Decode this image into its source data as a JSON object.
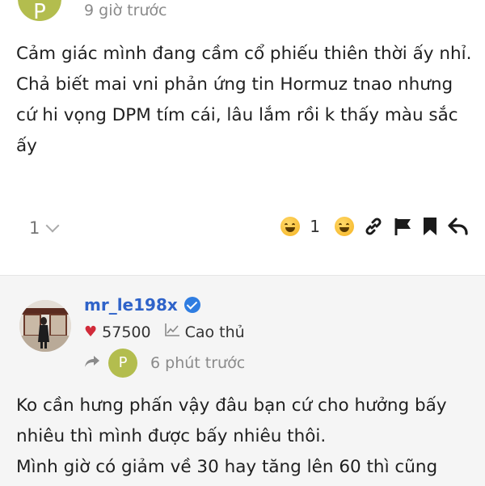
{
  "post1": {
    "avatar_letter": "P",
    "time": "9 giờ trước",
    "body": "Cảm giác mình đang cầm cổ phiếu thiên thời ấy nhỉ. Chả biết mai vni phản ứng tin Hormuz tnao nhưng cứ hi vọng DPM tím cái, lâu lắm rồi k thấy màu sắc ấy",
    "like_count": "1",
    "reaction_count": "1"
  },
  "post2": {
    "username": "mr_le198x",
    "points": "57500",
    "rank": "Cao thủ",
    "reply_avatar_letter": "P",
    "time": "6 phút trước",
    "body_line1": "Ko cần hưng phấn vậy đâu bạn cứ cho hưởng bấy nhiêu thì mình được bấy nhiêu thôi.",
    "body_line2": "Mình giờ có giảm về 30 hay tăng lên 60 thì cũng"
  },
  "icons": {
    "heart": "♥",
    "colors": {
      "accent": "#2f63c9",
      "heart": "#d12b3a",
      "avatar": "#b3bd4e"
    }
  }
}
